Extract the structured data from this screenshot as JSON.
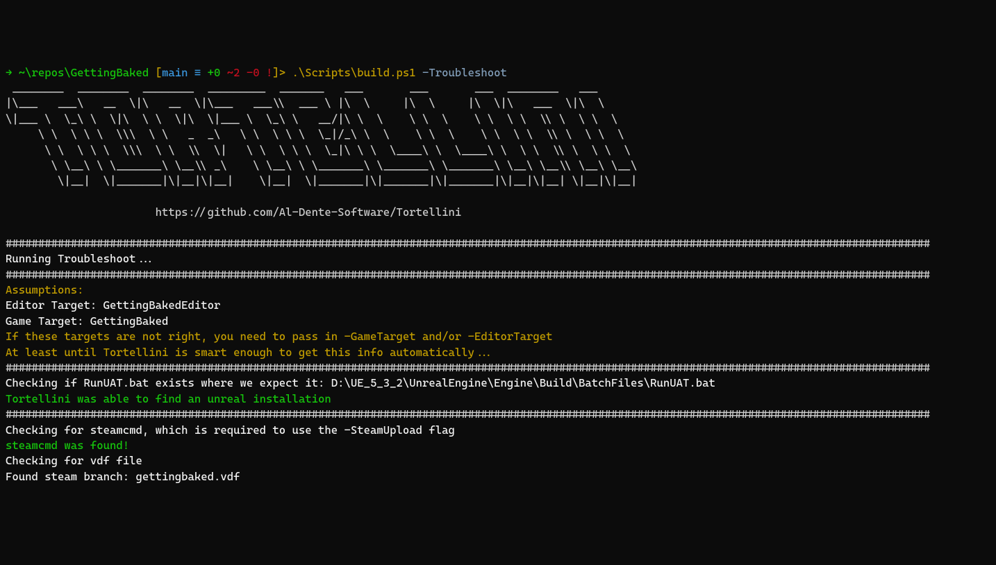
{
  "prompt": {
    "arrow": "→ ",
    "path": "~\\repos\\GettingBaked ",
    "bracket_open": "[",
    "branch": "main ",
    "equals": "≡ ",
    "git_add": "+0 ",
    "git_mod": "~2 ",
    "git_del": "-0 ",
    "git_dirty": "!",
    "bracket_close": "]",
    "chevron": "> ",
    "command": ".\\Scripts\\build.ps1 ",
    "command_arg": "-Troubleshoot"
  },
  "ascii_art": [
    " ________  ________  ________  _________  _______   ___       ___       ___  ________   ___     ",
    "|\\___   ___\\   __  \\|\\   __  \\|\\___   ___\\\\  ___ \\ |\\  \\     |\\  \\     |\\  \\|\\   ___  \\|\\  \\    ",
    "\\|___ \\  \\_\\ \\  \\|\\  \\ \\  \\|\\  \\|___ \\  \\_\\ \\   __/|\\ \\  \\    \\ \\  \\    \\ \\  \\ \\  \\\\ \\  \\ \\  \\   ",
    "     \\ \\  \\ \\ \\  \\\\\\  \\ \\   _  _\\   \\ \\  \\ \\ \\  \\_|/_\\ \\  \\    \\ \\  \\    \\ \\  \\ \\  \\\\ \\  \\ \\  \\  ",
    "      \\ \\  \\ \\ \\  \\\\\\  \\ \\  \\\\  \\|   \\ \\  \\ \\ \\  \\_|\\ \\ \\  \\____\\ \\  \\____\\ \\  \\ \\  \\\\ \\  \\ \\  \\ ",
    "       \\ \\__\\ \\ \\_______\\ \\__\\\\ _\\    \\ \\__\\ \\ \\_______\\ \\_______\\ \\_______\\ \\__\\ \\__\\\\ \\__\\ \\__\\",
    "        \\|__|  \\|_______|\\|__|\\|__|    \\|__|  \\|_______|\\|_______|\\|_______|\\|__|\\|__| \\|__|\\|__|"
  ],
  "url": "                       https://github.com/Al-Dente-Software/Tortellini",
  "hash_line": "##############################################################################################################################################",
  "output": {
    "running": "Running Troubleshoot...",
    "assumptions": "Assumptions:",
    "editor_target": "Editor Target: GettingBakedEditor",
    "game_target": "Game Target: GettingBaked",
    "warn1": "If these targets are not right, you need to pass in -GameTarget and/or -EditorTarget",
    "warn2": "At least until Tortellini is smart enough to get this info automatically...",
    "checking_runuat": "Checking if RunUAT.bat exists where we expect it: D:\\UE_5_3_2\\UnrealEngine\\Engine\\Build\\BatchFiles\\RunUAT.bat",
    "found_unreal": "Tortellini was able to find an unreal installation",
    "checking_steamcmd": "Checking for steamcmd, which is required to use the -SteamUpload flag",
    "steamcmd_found": "steamcmd was found!",
    "checking_vdf": "Checking for vdf file",
    "found_branch": "Found steam branch: gettingbaked.vdf"
  }
}
